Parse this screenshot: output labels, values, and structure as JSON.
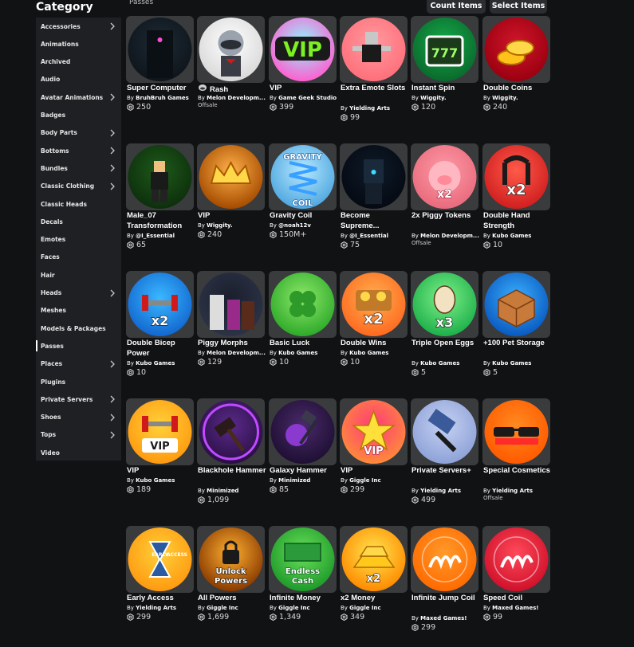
{
  "sidebar": {
    "title": "Category",
    "items": [
      {
        "label": "Accessories",
        "chevron": true
      },
      {
        "label": "Animations",
        "chevron": false
      },
      {
        "label": "Archived",
        "chevron": false
      },
      {
        "label": "Audio",
        "chevron": false
      },
      {
        "label": "Avatar Animations",
        "chevron": true
      },
      {
        "label": "Badges",
        "chevron": false
      },
      {
        "label": "Body Parts",
        "chevron": true
      },
      {
        "label": "Bottoms",
        "chevron": true
      },
      {
        "label": "Bundles",
        "chevron": true
      },
      {
        "label": "Classic Clothing",
        "chevron": true
      },
      {
        "label": "Classic Heads",
        "chevron": false
      },
      {
        "label": "Decals",
        "chevron": false
      },
      {
        "label": "Emotes",
        "chevron": false
      },
      {
        "label": "Faces",
        "chevron": false
      },
      {
        "label": "Hair",
        "chevron": false
      },
      {
        "label": "Heads",
        "chevron": true
      },
      {
        "label": "Meshes",
        "chevron": false
      },
      {
        "label": "Models & Packages",
        "chevron": false
      },
      {
        "label": "Passes",
        "chevron": false,
        "active": true
      },
      {
        "label": "Places",
        "chevron": true
      },
      {
        "label": "Plugins",
        "chevron": false
      },
      {
        "label": "Private Servers",
        "chevron": true
      },
      {
        "label": "Shoes",
        "chevron": true
      },
      {
        "label": "Tops",
        "chevron": true
      },
      {
        "label": "Video",
        "chevron": false
      }
    ]
  },
  "header": {
    "section_label": "Passes",
    "count_items_label": "Count Items",
    "select_items_label": "Select Items"
  },
  "items": [
    {
      "name": "Super Computer",
      "creator": "BruhBruh Games",
      "price": "250",
      "icon": "super-computer-thumbnail"
    },
    {
      "name": "Rash",
      "creator": "Melon Developm...",
      "offsale": "Offsale",
      "name_icon": true,
      "icon": "raccoon-character-thumbnail"
    },
    {
      "name": "VIP",
      "creator": "Game Geek Studio",
      "price": "399",
      "icon": "vip-rainbow-thumbnail"
    },
    {
      "name": "Extra Emote Slots",
      "creator": "Yielding Arts",
      "price": "99",
      "icon": "emote-character-thumbnail"
    },
    {
      "name": "Instant Spin",
      "creator": "Wiggity.",
      "price": "120",
      "icon": "slot-machine-thumbnail"
    },
    {
      "name": "Double Coins",
      "creator": "Wiggity.",
      "price": "240",
      "icon": "coins-thumbnail"
    },
    {
      "name": "Male_07 Transformation",
      "creator": "@I_Essential",
      "price": "65",
      "icon": "male-character-thumbnail"
    },
    {
      "name": "VIP",
      "creator": "Wiggity.",
      "price": "240",
      "icon": "crown-thumbnail"
    },
    {
      "name": "Gravity Coil",
      "creator": "@noah12v",
      "price": "150M+",
      "icon": "gravity-coil-thumbnail",
      "icon_text": "GRAVITY|COIL"
    },
    {
      "name": "Become Supreme...",
      "creator": "@I_Essential",
      "price": "75",
      "icon": "dark-figure-thumbnail"
    },
    {
      "name": "2x Piggy Tokens",
      "creator": "Melon Developm...",
      "offsale": "Offsale",
      "icon": "piggy-tokens-thumbnail",
      "icon_text": "x2"
    },
    {
      "name": "Double Hand Strength",
      "creator": "Kubo Games",
      "price": "10",
      "icon": "hand-grip-thumbnail",
      "icon_text": "x2"
    },
    {
      "name": "Double Bicep Power",
      "creator": "Kubo Games",
      "price": "10",
      "icon": "dumbbell-x2-thumbnail",
      "icon_text": "x2"
    },
    {
      "name": "Piggy Morphs",
      "creator": "Melon Developm...",
      "price": "129",
      "icon": "piggy-morphs-thumbnail"
    },
    {
      "name": "Basic Luck",
      "creator": "Kubo Games",
      "price": "10",
      "icon": "clover-thumbnail"
    },
    {
      "name": "Double Wins",
      "creator": "Kubo Games",
      "price": "10",
      "icon": "treasure-thumbnail",
      "icon_text": "x2"
    },
    {
      "name": "Triple Open Eggs",
      "creator": "Kubo Games",
      "price": "5",
      "icon": "egg-thumbnail",
      "icon_text": "x3"
    },
    {
      "name": "+100 Pet Storage",
      "creator": "Kubo Games",
      "price": "5",
      "icon": "boxes-thumbnail"
    },
    {
      "name": "VIP",
      "creator": "Kubo Games",
      "price": "189",
      "icon": "vip-dumbbell-thumbnail",
      "icon_text": "VIP"
    },
    {
      "name": "Blackhole Hammer",
      "creator": "Minimized",
      "price": "1,099",
      "icon": "blackhole-hammer-thumbnail"
    },
    {
      "name": "Galaxy Hammer",
      "creator": "Minimized",
      "price": "85",
      "icon": "galaxy-hammer-thumbnail"
    },
    {
      "name": "VIP",
      "creator": "Giggle Inc",
      "price": "299",
      "icon": "vip-star-thumbnail",
      "icon_text": "VIP"
    },
    {
      "name": "Private Servers+",
      "creator": "Yielding Arts",
      "price": "499",
      "icon": "hammer-thumbnail"
    },
    {
      "name": "Special Cosmetics",
      "creator": "Yielding Arts",
      "offsale": "Offsale",
      "icon": "sunglasses-thumbnail"
    },
    {
      "name": "Early Access",
      "creator": "Yielding Arts",
      "price": "299",
      "icon": "hourglass-thumbnail",
      "icon_text": "EARLY|ACCESS"
    },
    {
      "name": "All Powers",
      "creator": "Giggle Inc",
      "price": "1,699",
      "icon": "unlock-powers-thumbnail",
      "icon_text": "Unlock|Powers"
    },
    {
      "name": "Infinite Money",
      "creator": "Giggle Inc",
      "price": "1,349",
      "icon": "endless-cash-thumbnail",
      "icon_text": "Endless|Cash"
    },
    {
      "name": "x2 Money",
      "creator": "Giggle Inc",
      "price": "349",
      "icon": "gold-bars-thumbnail",
      "icon_text": "x2"
    },
    {
      "name": "Infinite Jump Coil",
      "creator": "Maxed Games!",
      "price": "299",
      "icon": "orange-coil-thumbnail"
    },
    {
      "name": "Speed Coil",
      "creator": "Maxed Games!",
      "price": "99",
      "icon": "red-coil-thumbnail"
    }
  ]
}
